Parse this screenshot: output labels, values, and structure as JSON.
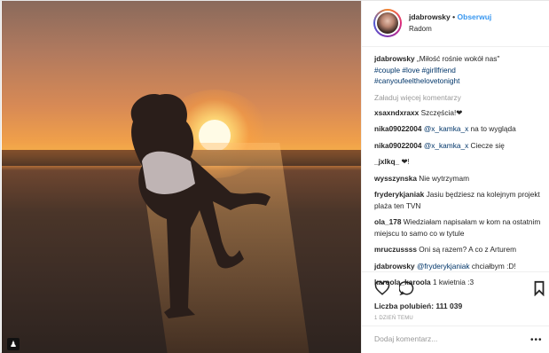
{
  "post": {
    "author": "jdabrowsky",
    "separator": "•",
    "follow_label": "Obserwuj",
    "location": "Radom",
    "caption_text": "„Miłość rośnie wokół nas\"",
    "caption_tags": [
      "#couple",
      "#love",
      "#girllfriend",
      "#canyoufeelthelovetonight"
    ],
    "load_more": "Załaduj więcej komentarzy",
    "likes": "Liczba polubień: 111 039",
    "time": "1 DZIEŃ TEMU",
    "add_comment_placeholder": "Dodaj komentarz...",
    "more_icon": "•••"
  },
  "comments": [
    {
      "user": "xsaxndxraxx",
      "text": "Szczęścia!❤"
    },
    {
      "user": "nika09022004",
      "mention": "@x_kamka_x",
      "text": " na to wygląda"
    },
    {
      "user": "nika09022004",
      "mention": "@x_kamka_x",
      "text": " Ciecze się"
    },
    {
      "user": "_jxlkq_",
      "text": " ❤!"
    },
    {
      "user": "wysszynska",
      "text": "Nie wytrzymam"
    },
    {
      "user": "fryderykjaniak",
      "text": "Jasiu będziesz na kolejnym projekt plaża ten TVN"
    },
    {
      "user": "ola_178",
      "text": "Wiedziałam napisałam w kom na ostatnim miejscu to samo co w tytule"
    },
    {
      "user": "mruczussss",
      "text": "Oni są razem? A co z Arturem"
    },
    {
      "user": "jdabrowsky",
      "mention": "@fryderykjaniak",
      "text": " chciałbym :D!"
    },
    {
      "user": "karoola_karoola",
      "text": "1 kwietnia :3"
    }
  ],
  "icons": {
    "heart": "heart-icon",
    "comment": "comment-icon",
    "save": "bookmark-icon",
    "photo_tag": "person-tag-icon"
  },
  "colors": {
    "link": "#3897f0",
    "tag": "#003569",
    "muted": "#999999"
  }
}
